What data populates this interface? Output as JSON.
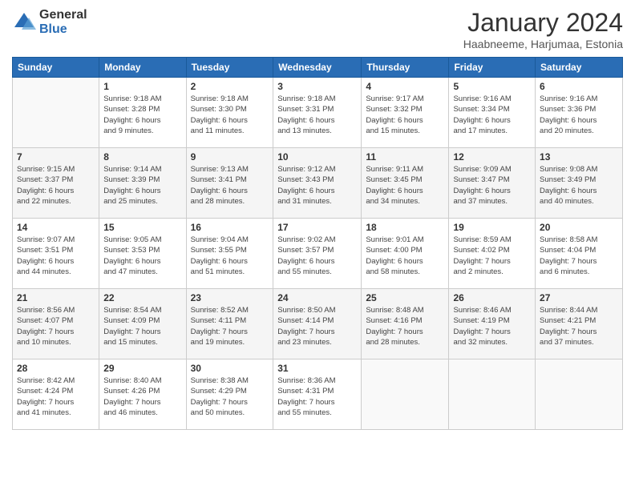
{
  "header": {
    "logo_general": "General",
    "logo_blue": "Blue",
    "month_title": "January 2024",
    "location": "Haabneeme, Harjumaa, Estonia"
  },
  "days_of_week": [
    "Sunday",
    "Monday",
    "Tuesday",
    "Wednesday",
    "Thursday",
    "Friday",
    "Saturday"
  ],
  "weeks": [
    [
      {
        "day": "",
        "info": ""
      },
      {
        "day": "1",
        "info": "Sunrise: 9:18 AM\nSunset: 3:28 PM\nDaylight: 6 hours\nand 9 minutes."
      },
      {
        "day": "2",
        "info": "Sunrise: 9:18 AM\nSunset: 3:30 PM\nDaylight: 6 hours\nand 11 minutes."
      },
      {
        "day": "3",
        "info": "Sunrise: 9:18 AM\nSunset: 3:31 PM\nDaylight: 6 hours\nand 13 minutes."
      },
      {
        "day": "4",
        "info": "Sunrise: 9:17 AM\nSunset: 3:32 PM\nDaylight: 6 hours\nand 15 minutes."
      },
      {
        "day": "5",
        "info": "Sunrise: 9:16 AM\nSunset: 3:34 PM\nDaylight: 6 hours\nand 17 minutes."
      },
      {
        "day": "6",
        "info": "Sunrise: 9:16 AM\nSunset: 3:36 PM\nDaylight: 6 hours\nand 20 minutes."
      }
    ],
    [
      {
        "day": "7",
        "info": "Sunrise: 9:15 AM\nSunset: 3:37 PM\nDaylight: 6 hours\nand 22 minutes."
      },
      {
        "day": "8",
        "info": "Sunrise: 9:14 AM\nSunset: 3:39 PM\nDaylight: 6 hours\nand 25 minutes."
      },
      {
        "day": "9",
        "info": "Sunrise: 9:13 AM\nSunset: 3:41 PM\nDaylight: 6 hours\nand 28 minutes."
      },
      {
        "day": "10",
        "info": "Sunrise: 9:12 AM\nSunset: 3:43 PM\nDaylight: 6 hours\nand 31 minutes."
      },
      {
        "day": "11",
        "info": "Sunrise: 9:11 AM\nSunset: 3:45 PM\nDaylight: 6 hours\nand 34 minutes."
      },
      {
        "day": "12",
        "info": "Sunrise: 9:09 AM\nSunset: 3:47 PM\nDaylight: 6 hours\nand 37 minutes."
      },
      {
        "day": "13",
        "info": "Sunrise: 9:08 AM\nSunset: 3:49 PM\nDaylight: 6 hours\nand 40 minutes."
      }
    ],
    [
      {
        "day": "14",
        "info": "Sunrise: 9:07 AM\nSunset: 3:51 PM\nDaylight: 6 hours\nand 44 minutes."
      },
      {
        "day": "15",
        "info": "Sunrise: 9:05 AM\nSunset: 3:53 PM\nDaylight: 6 hours\nand 47 minutes."
      },
      {
        "day": "16",
        "info": "Sunrise: 9:04 AM\nSunset: 3:55 PM\nDaylight: 6 hours\nand 51 minutes."
      },
      {
        "day": "17",
        "info": "Sunrise: 9:02 AM\nSunset: 3:57 PM\nDaylight: 6 hours\nand 55 minutes."
      },
      {
        "day": "18",
        "info": "Sunrise: 9:01 AM\nSunset: 4:00 PM\nDaylight: 6 hours\nand 58 minutes."
      },
      {
        "day": "19",
        "info": "Sunrise: 8:59 AM\nSunset: 4:02 PM\nDaylight: 7 hours\nand 2 minutes."
      },
      {
        "day": "20",
        "info": "Sunrise: 8:58 AM\nSunset: 4:04 PM\nDaylight: 7 hours\nand 6 minutes."
      }
    ],
    [
      {
        "day": "21",
        "info": "Sunrise: 8:56 AM\nSunset: 4:07 PM\nDaylight: 7 hours\nand 10 minutes."
      },
      {
        "day": "22",
        "info": "Sunrise: 8:54 AM\nSunset: 4:09 PM\nDaylight: 7 hours\nand 15 minutes."
      },
      {
        "day": "23",
        "info": "Sunrise: 8:52 AM\nSunset: 4:11 PM\nDaylight: 7 hours\nand 19 minutes."
      },
      {
        "day": "24",
        "info": "Sunrise: 8:50 AM\nSunset: 4:14 PM\nDaylight: 7 hours\nand 23 minutes."
      },
      {
        "day": "25",
        "info": "Sunrise: 8:48 AM\nSunset: 4:16 PM\nDaylight: 7 hours\nand 28 minutes."
      },
      {
        "day": "26",
        "info": "Sunrise: 8:46 AM\nSunset: 4:19 PM\nDaylight: 7 hours\nand 32 minutes."
      },
      {
        "day": "27",
        "info": "Sunrise: 8:44 AM\nSunset: 4:21 PM\nDaylight: 7 hours\nand 37 minutes."
      }
    ],
    [
      {
        "day": "28",
        "info": "Sunrise: 8:42 AM\nSunset: 4:24 PM\nDaylight: 7 hours\nand 41 minutes."
      },
      {
        "day": "29",
        "info": "Sunrise: 8:40 AM\nSunset: 4:26 PM\nDaylight: 7 hours\nand 46 minutes."
      },
      {
        "day": "30",
        "info": "Sunrise: 8:38 AM\nSunset: 4:29 PM\nDaylight: 7 hours\nand 50 minutes."
      },
      {
        "day": "31",
        "info": "Sunrise: 8:36 AM\nSunset: 4:31 PM\nDaylight: 7 hours\nand 55 minutes."
      },
      {
        "day": "",
        "info": ""
      },
      {
        "day": "",
        "info": ""
      },
      {
        "day": "",
        "info": ""
      }
    ]
  ]
}
